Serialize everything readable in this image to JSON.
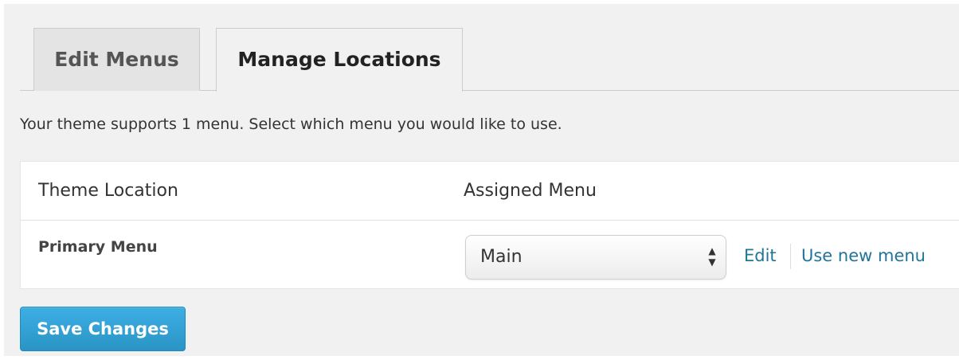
{
  "tabs": [
    {
      "label": "Edit Menus",
      "active": false
    },
    {
      "label": "Manage Locations",
      "active": true
    }
  ],
  "intro_text": "Your theme supports 1 menu. Select which menu you would like to use.",
  "table": {
    "headers": {
      "theme_location": "Theme Location",
      "assigned_menu": "Assigned Menu"
    },
    "rows": [
      {
        "location": "Primary Menu",
        "selected_menu": "Main",
        "edit_link": "Edit",
        "new_menu_link": "Use new menu"
      }
    ]
  },
  "save_button": "Save Changes",
  "icons": {
    "select_arrows": "up-down-chevron-icon"
  },
  "colors": {
    "link": "#21759b",
    "primary_button": "#2ea2cc",
    "page_background": "#f1f1f1"
  }
}
